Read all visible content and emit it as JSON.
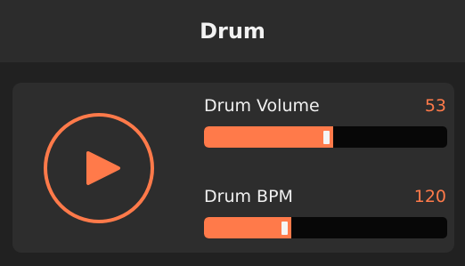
{
  "header": {
    "title": "Drum"
  },
  "colors": {
    "accent": "#ff7a4a",
    "background": "#212121",
    "header_bg": "#2c2c2c",
    "card_bg": "#2d2d2d",
    "track": "#070707"
  },
  "player": {
    "play_icon": "play-icon"
  },
  "controls": {
    "volume": {
      "label": "Drum Volume",
      "value": "53",
      "fraction": 0.53
    },
    "bpm": {
      "label": "Drum BPM",
      "value": "120",
      "fraction": 0.36
    }
  }
}
